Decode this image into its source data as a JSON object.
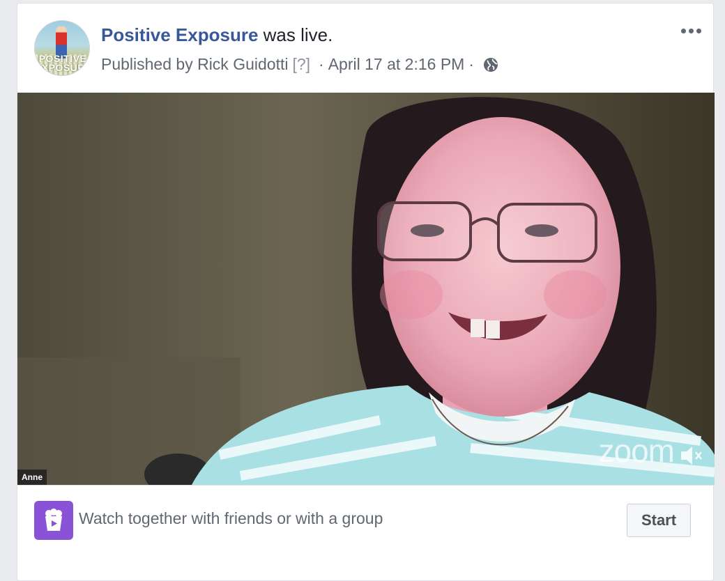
{
  "post": {
    "page_name": "Positive Exposure",
    "action_text": "was live.",
    "published_by": "Published by Rick Guidotti",
    "help_marker": "[?]",
    "timestamp": "April 17 at 2:16 PM",
    "separator": "·",
    "privacy_icon": "globe-icon",
    "more_icon": "more-options-icon",
    "avatar_text_line1": "POSITIVE",
    "avatar_text_line2": "EXPOSURE"
  },
  "video": {
    "participant_name": "Anne",
    "watermark": "zoom",
    "mute_icon": "speaker-muted-icon"
  },
  "watch_party": {
    "icon": "popcorn-play-icon",
    "prompt": "Watch together with friends or with a group",
    "start_label": "Start"
  },
  "colors": {
    "page_link": "#385898",
    "meta_text": "#606770",
    "watch_icon_bg": "#8a52d6",
    "card_bg": "#ffffff",
    "page_bg": "#e9ebee"
  }
}
